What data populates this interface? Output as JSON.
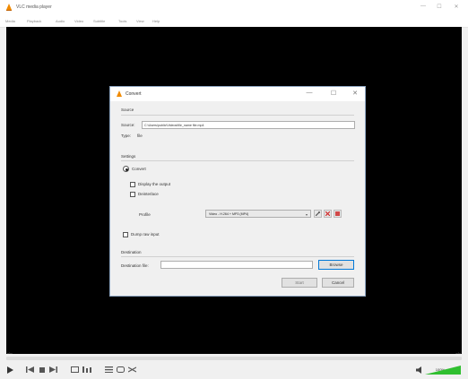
{
  "window": {
    "title": "VLC media player",
    "controls": [
      "—",
      "☐",
      "✕"
    ]
  },
  "menu": [
    "Media",
    "Playback",
    "Audio",
    "Video",
    "Subtitle",
    "Tools",
    "View",
    "Help"
  ],
  "player": {
    "time_elapsed": "--:--",
    "time_total": "--:--",
    "volume_label": "100%",
    "volume_level": 1.0
  },
  "dialog": {
    "title": "Convert",
    "source_section": "Source",
    "source_label": "Source:",
    "source_value": "C:\\Users\\public\\Videos\\file_name file.mp4",
    "type_label": "Type:",
    "type_value": "file",
    "settings_section": "Settings",
    "convert_label": "Convert",
    "display_output_label": "Display the output",
    "deinterlace_label": "Deinterlace",
    "profile_label": "Profile",
    "profile_value": "Video - H.264 + MP3 (MP4)",
    "dump_raw_label": "Dump raw input",
    "destination_section": "Destination",
    "destination_label": "Destination file:",
    "destination_value": "",
    "browse_label": "Browse",
    "start_label": "Start",
    "cancel_label": "Cancel"
  }
}
